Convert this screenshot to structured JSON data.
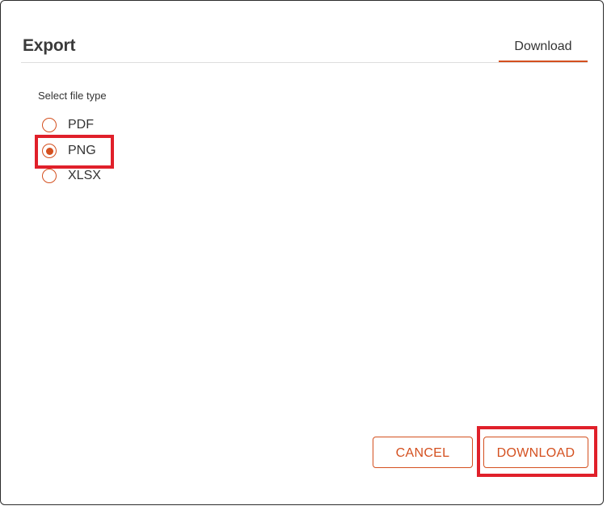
{
  "dialog": {
    "title": "Export",
    "tab_label": "Download"
  },
  "file_type": {
    "label": "Select file type",
    "options": [
      {
        "label": "PDF",
        "selected": false
      },
      {
        "label": "PNG",
        "selected": true
      },
      {
        "label": "XLSX",
        "selected": false
      }
    ]
  },
  "footer": {
    "cancel_label": "CANCEL",
    "download_label": "DOWNLOAD"
  },
  "colors": {
    "accent": "#d4501f",
    "highlight": "#e0202a"
  }
}
